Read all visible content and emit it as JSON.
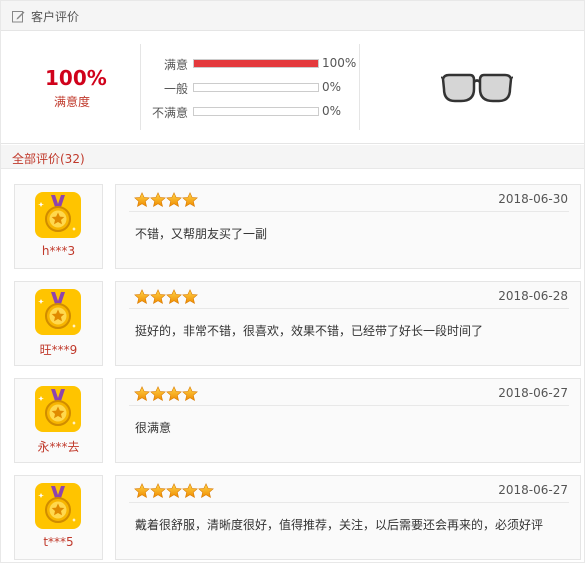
{
  "header": {
    "title": "客户评价",
    "icon": "edit-icon"
  },
  "summary": {
    "satisfaction_percent": "100%",
    "satisfaction_label": "满意度",
    "ratings": [
      {
        "label": "满意",
        "value": "100%",
        "fraction": 1.0
      },
      {
        "label": "一般",
        "value": "0%",
        "fraction": 0
      },
      {
        "label": "不满意",
        "value": "0%",
        "fraction": 0
      }
    ],
    "product_image": "glasses-image",
    "bar_color": "#e4393c"
  },
  "all_reviews": {
    "label": "全部评价(32)"
  },
  "reviews": [
    {
      "user": "h***3",
      "stars": 4,
      "date": "2018-06-30",
      "text": "不错，又帮朋友买了一副"
    },
    {
      "user": "旺***9",
      "stars": 4,
      "date": "2018-06-28",
      "text": "挺好的，非常不错，很喜欢，效果不错，已经带了好长一段时间了"
    },
    {
      "user": "永***去",
      "stars": 4,
      "date": "2018-06-27",
      "text": "很满意"
    },
    {
      "user": "t***5",
      "stars": 5,
      "date": "2018-06-27",
      "text": "戴着很舒服，清晰度很好，值得推荐，关注，以后需要还会再来的，必须好评"
    }
  ],
  "colors": {
    "accent": "#d0021b",
    "star": "#f5a623",
    "avatar_bg": "#ffc400"
  }
}
